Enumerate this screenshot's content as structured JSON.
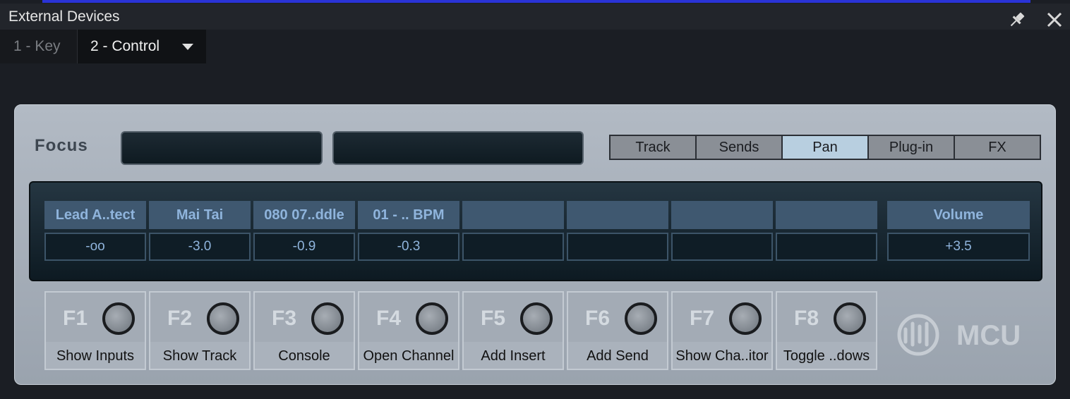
{
  "window": {
    "title": "External Devices"
  },
  "tabs": [
    {
      "label": "1 - Key",
      "active": false
    },
    {
      "label": "2 - Control",
      "active": true
    }
  ],
  "focus": {
    "label": "Focus",
    "box1": "",
    "box2": ""
  },
  "modes": [
    {
      "label": "Track",
      "active": false
    },
    {
      "label": "Sends",
      "active": false
    },
    {
      "label": "Pan",
      "active": true
    },
    {
      "label": "Plug-in",
      "active": false
    },
    {
      "label": "FX",
      "active": false
    }
  ],
  "channels": [
    {
      "name": "Lead A..tect",
      "value": "-oo"
    },
    {
      "name": "Mai Tai",
      "value": "-3.0"
    },
    {
      "name": "080 07..ddle",
      "value": "-0.9"
    },
    {
      "name": "01 - .. BPM",
      "value": "-0.3"
    },
    {
      "name": "",
      "value": ""
    },
    {
      "name": "",
      "value": ""
    },
    {
      "name": "",
      "value": ""
    },
    {
      "name": "",
      "value": ""
    }
  ],
  "master": {
    "name": "Volume",
    "value": "+3.5"
  },
  "fkeys": [
    {
      "key": "F1",
      "action": "Show Inputs"
    },
    {
      "key": "F2",
      "action": "Show Track"
    },
    {
      "key": "F3",
      "action": "Console"
    },
    {
      "key": "F4",
      "action": "Open Channel"
    },
    {
      "key": "F5",
      "action": "Add Insert"
    },
    {
      "key": "F6",
      "action": "Add Send"
    },
    {
      "key": "F7",
      "action": "Show Cha..itor"
    },
    {
      "key": "F8",
      "action": "Toggle ..dows"
    }
  ],
  "logo": {
    "text": "MCU",
    "icon": "presonus-logo-icon"
  },
  "colors": {
    "accent": "#b8cfe0",
    "display_text": "#8fb4dc",
    "blue_strip": "#2a33d6"
  }
}
